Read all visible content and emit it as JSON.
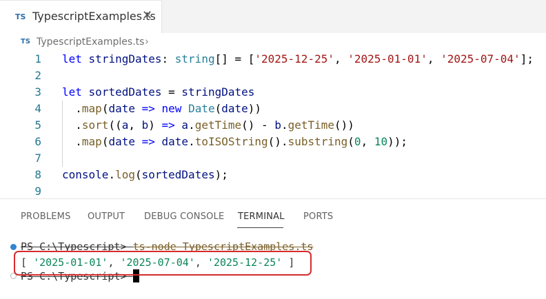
{
  "tab": {
    "badge": "TS",
    "label": "TypescriptExamples.ts",
    "close": "✕"
  },
  "breadcrumb": {
    "badge": "TS",
    "file": "TypescriptExamples.ts",
    "chevron": "›"
  },
  "editor": {
    "lines": [
      {
        "num": "1",
        "tokens": [
          {
            "c": "k",
            "t": "let"
          },
          {
            "c": "p",
            "t": " "
          },
          {
            "c": "v",
            "t": "stringDates"
          },
          {
            "c": "p",
            "t": ": "
          },
          {
            "c": "t",
            "t": "string"
          },
          {
            "c": "p",
            "t": "[] = ["
          },
          {
            "c": "s",
            "t": "'2025-12-25'"
          },
          {
            "c": "p",
            "t": ", "
          },
          {
            "c": "s",
            "t": "'2025-01-01'"
          },
          {
            "c": "p",
            "t": ", "
          },
          {
            "c": "s",
            "t": "'2025-07-04'"
          },
          {
            "c": "p",
            "t": "];"
          }
        ]
      },
      {
        "num": "2",
        "tokens": []
      },
      {
        "num": "3",
        "tokens": [
          {
            "c": "k",
            "t": "let"
          },
          {
            "c": "p",
            "t": " "
          },
          {
            "c": "v",
            "t": "sortedDates"
          },
          {
            "c": "p",
            "t": " = "
          },
          {
            "c": "v",
            "t": "stringDates"
          }
        ]
      },
      {
        "num": "4",
        "tokens": [
          {
            "c": "p",
            "t": "  ."
          },
          {
            "c": "f",
            "t": "map"
          },
          {
            "c": "p",
            "t": "("
          },
          {
            "c": "v",
            "t": "date"
          },
          {
            "c": "p",
            "t": " "
          },
          {
            "c": "k",
            "t": "=>"
          },
          {
            "c": "p",
            "t": " "
          },
          {
            "c": "k",
            "t": "new"
          },
          {
            "c": "p",
            "t": " "
          },
          {
            "c": "t",
            "t": "Date"
          },
          {
            "c": "p",
            "t": "("
          },
          {
            "c": "v",
            "t": "date"
          },
          {
            "c": "p",
            "t": "))"
          }
        ]
      },
      {
        "num": "5",
        "tokens": [
          {
            "c": "p",
            "t": "  ."
          },
          {
            "c": "f",
            "t": "sort"
          },
          {
            "c": "p",
            "t": "(("
          },
          {
            "c": "v",
            "t": "a"
          },
          {
            "c": "p",
            "t": ", "
          },
          {
            "c": "v",
            "t": "b"
          },
          {
            "c": "p",
            "t": ") "
          },
          {
            "c": "k",
            "t": "=>"
          },
          {
            "c": "p",
            "t": " "
          },
          {
            "c": "v",
            "t": "a"
          },
          {
            "c": "p",
            "t": "."
          },
          {
            "c": "f",
            "t": "getTime"
          },
          {
            "c": "p",
            "t": "() - "
          },
          {
            "c": "v",
            "t": "b"
          },
          {
            "c": "p",
            "t": "."
          },
          {
            "c": "f",
            "t": "getTime"
          },
          {
            "c": "p",
            "t": "())"
          }
        ]
      },
      {
        "num": "6",
        "tokens": [
          {
            "c": "p",
            "t": "  ."
          },
          {
            "c": "f",
            "t": "map"
          },
          {
            "c": "p",
            "t": "("
          },
          {
            "c": "v",
            "t": "date"
          },
          {
            "c": "p",
            "t": " "
          },
          {
            "c": "k",
            "t": "=>"
          },
          {
            "c": "p",
            "t": " "
          },
          {
            "c": "v",
            "t": "date"
          },
          {
            "c": "p",
            "t": "."
          },
          {
            "c": "f",
            "t": "toISOString"
          },
          {
            "c": "p",
            "t": "()."
          },
          {
            "c": "f",
            "t": "substring"
          },
          {
            "c": "p",
            "t": "("
          },
          {
            "c": "n",
            "t": "0"
          },
          {
            "c": "p",
            "t": ", "
          },
          {
            "c": "n",
            "t": "10"
          },
          {
            "c": "p",
            "t": "));"
          }
        ]
      },
      {
        "num": "7",
        "tokens": []
      },
      {
        "num": "8",
        "tokens": [
          {
            "c": "v",
            "t": "console"
          },
          {
            "c": "p",
            "t": "."
          },
          {
            "c": "f",
            "t": "log"
          },
          {
            "c": "p",
            "t": "("
          },
          {
            "c": "v",
            "t": "sortedDates"
          },
          {
            "c": "p",
            "t": ");"
          }
        ]
      },
      {
        "num": "9",
        "tokens": []
      }
    ]
  },
  "panel": {
    "tabs": [
      "PROBLEMS",
      "OUTPUT",
      "DEBUG CONSOLE",
      "TERMINAL",
      "PORTS"
    ],
    "active": "TERMINAL"
  },
  "terminal": {
    "prompt1": "PS C:\\Typescript> ",
    "command": "ts-node TypescriptExamples.ts",
    "output_open": "[ ",
    "output_items": [
      "'2025-01-01'",
      "'2025-07-04'",
      "'2025-12-25'"
    ],
    "output_sep": ", ",
    "output_close": " ]",
    "prompt2": "PS C:\\Typescript> "
  },
  "colors": {
    "highlight_border": "#d52b2b",
    "ts_badge": "#2d6fa6"
  }
}
